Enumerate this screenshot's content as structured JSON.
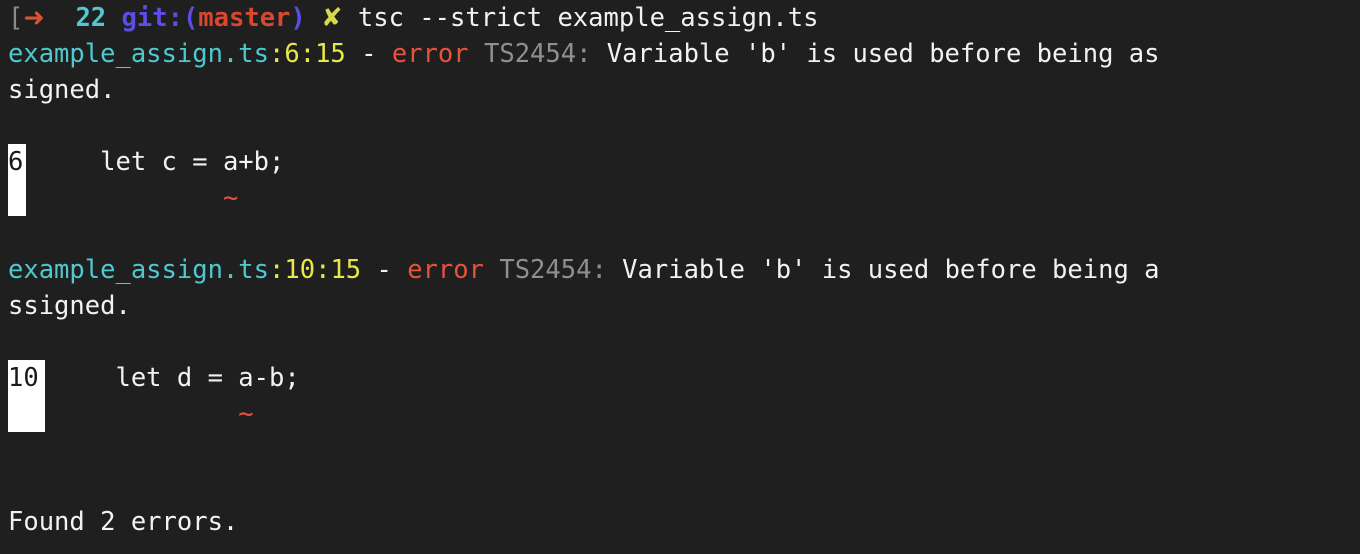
{
  "terminal": {
    "background": "#201f1f",
    "foreground": "#f2f2f2",
    "columns": 78,
    "rows": 15
  },
  "prompt": {
    "left_bracket": "[",
    "arrow_icon": "➜",
    "gap1": "  ",
    "jobs": "22",
    "gap2": " ",
    "git_prefix": "git:(",
    "branch": "master",
    "git_suffix": ")",
    "gap3": " ",
    "status_icon": "✘",
    "gap4": " ",
    "command": "tsc --strict example_assign.ts",
    "colors": {
      "bracket": "#8a8a8a",
      "arrow": "#e0502f",
      "jobs": "#4ec9cf",
      "git": "#5c4ee5",
      "branch": "#d9472f",
      "status": "#d8d84a",
      "command": "#f2f2f2"
    }
  },
  "diagnostics": [
    {
      "file": "example_assign.ts",
      "colon1": ":",
      "line": "6",
      "colon2": ":",
      "column": "15",
      "separator": " - ",
      "severity": "error",
      "code": "TS2454:",
      "message_part1": " Variable 'b' is used before being as",
      "message_part2": "signed.",
      "excerpt": {
        "line_number": "6",
        "gutter_width": "w1",
        "code_indent": "  ",
        "code_text": "    let c = a+b;",
        "squiggle_indent": "  ",
        "squiggle_pad": "            ",
        "squiggle": "~"
      }
    },
    {
      "file": "example_assign.ts",
      "colon1": ":",
      "line": "10",
      "colon2": ":",
      "column": "15",
      "separator": " - ",
      "severity": "error",
      "code": "TS2454:",
      "message_part1": " Variable 'b' is used before being a",
      "message_part2": "ssigned.",
      "excerpt": {
        "line_number": "10",
        "gutter_width": "w2",
        "code_indent": "   ",
        "code_text": "    let d = a-b;",
        "squiggle_indent": "   ",
        "squiggle_pad": "            ",
        "squiggle": "~"
      }
    }
  ],
  "summary": {
    "text": "Found 2 errors."
  },
  "colors": {
    "file": "#4ec9cf",
    "position": "#e8e84a",
    "severity": "#e8513a",
    "code": "#8f8f8f",
    "message": "#f2f2f2",
    "squiggle": "#e8513a",
    "gutter_bg": "#ffffff",
    "gutter_fg": "#1a1a1a"
  }
}
